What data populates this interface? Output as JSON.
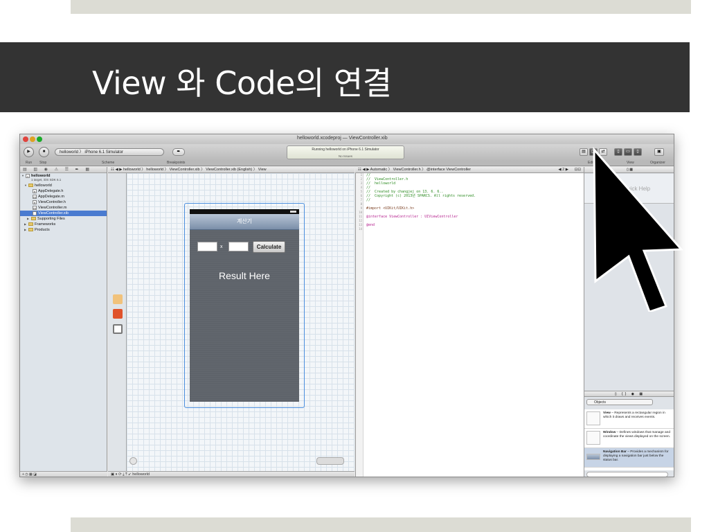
{
  "slide": {
    "title": "View 와 Code의 연결"
  },
  "xcode": {
    "window_title": "helloworld.xcodeproj — ViewController.xib",
    "toolbar": {
      "run_label": "Run",
      "stop_label": "Stop",
      "scheme_text": "helloworld 〉 iPhone 6.1 Simulator",
      "scheme_label": "Scheme",
      "breakpoints_label": "Breakpoints",
      "activity_status": "Running helloworld on iPhone 6.1 Simulator",
      "activity_issues": "No Issues",
      "editor_label": "Editor",
      "view_label": "View",
      "organizer_label": "Organizer"
    },
    "navigator": {
      "project_name": "helloworld",
      "project_sub": "1 target, iOS SDK 6.1",
      "items": [
        {
          "label": "helloworld",
          "type": "folder"
        },
        {
          "label": "AppDelegate.h",
          "type": "h"
        },
        {
          "label": "AppDelegate.m",
          "type": "m"
        },
        {
          "label": "ViewController.h",
          "type": "h"
        },
        {
          "label": "ViewController.m",
          "type": "m"
        },
        {
          "label": "ViewController.xib",
          "type": "xib"
        },
        {
          "label": "Supporting Files",
          "type": "folder"
        },
        {
          "label": "Frameworks",
          "type": "folder"
        },
        {
          "label": "Products",
          "type": "folder"
        }
      ]
    },
    "ib_jumpbar": "helloworld 〉 helloworld 〉 ViewController.xib 〉 ViewController.xib (English) 〉 View",
    "editor_jumpbar": "Automatic 〉 ViewController.h 〉 @interface ViewController",
    "editor_counter": "◀ 2 ▶",
    "bottom_bar_label": "helloworld",
    "phone": {
      "nav_title": "계산기",
      "x_label": "x",
      "calc_button": "Calculate",
      "result_label": "Result Here"
    },
    "code_lines": [
      {
        "n": "1",
        "t": "//",
        "c": "c-com"
      },
      {
        "n": "2",
        "t": "//  ViewController.h",
        "c": "c-com"
      },
      {
        "n": "3",
        "t": "//  helloworld",
        "c": "c-com"
      },
      {
        "n": "4",
        "t": "//",
        "c": "c-com"
      },
      {
        "n": "5",
        "t": "//  Created by changjej on 13. 6. 6..",
        "c": "c-com"
      },
      {
        "n": "6",
        "t": "//  Copyright (c) 2013년 SPARCS. All rights reserved.",
        "c": "c-com"
      },
      {
        "n": "7",
        "t": "//",
        "c": "c-com"
      },
      {
        "n": "8",
        "t": "",
        "c": "c-plain"
      },
      {
        "n": "9",
        "t": "#import <UIKit/UIKit.h>",
        "c": "c-pre"
      },
      {
        "n": "10",
        "t": "",
        "c": "c-plain"
      },
      {
        "n": "11",
        "t": "@interface ViewController : UIViewController",
        "c": "c-key"
      },
      {
        "n": "12",
        "t": "",
        "c": "c-plain"
      },
      {
        "n": "13",
        "t": "@end",
        "c": "c-key"
      },
      {
        "n": "14",
        "t": "",
        "c": "c-plain"
      }
    ],
    "utilities": {
      "quick_help": "Quick Help",
      "library_selector": "Objects",
      "library_items": [
        {
          "name": "View",
          "desc": " – Represents a rectangular region in which it draws and receives events."
        },
        {
          "name": "Window",
          "desc": " – Defines windows that manage and coordinate the views displayed on the screen."
        },
        {
          "name": "Navigation Bar",
          "desc": " – Provides a mechanism for displaying a navigation bar just below the status bar."
        }
      ]
    }
  },
  "colors": {
    "title_bar": "#333333",
    "band": "#dcdcd4",
    "selection_blue": "#4a8ede",
    "comment_green": "#2a8a1f",
    "keyword_purple": "#b41d8c"
  },
  "icons": [
    "run-icon",
    "stop-icon",
    "mouse-pointer-icon",
    "folder-icon",
    "file-icon"
  ]
}
